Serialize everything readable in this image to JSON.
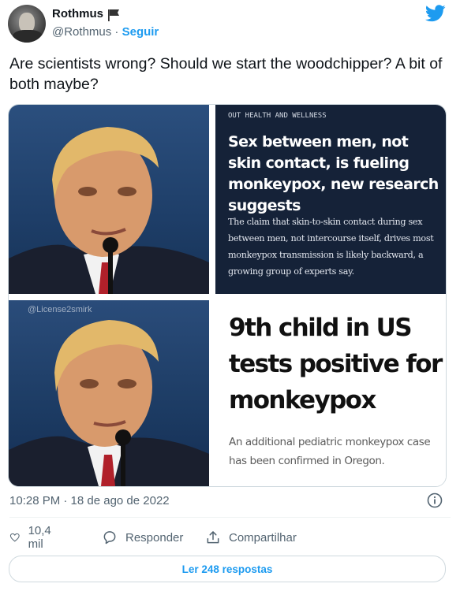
{
  "user": {
    "name": "Rothmus",
    "handle": "@Rothmus",
    "separator": "·",
    "follow_label": "Seguir"
  },
  "tweet": {
    "text": "Are scientists wrong? Should we start the woodchipper? A bit of both maybe?",
    "timestamp": "10:28 PM · 18 de ago de 2022"
  },
  "media": {
    "watermark": "@License2smirk",
    "article1": {
      "kicker": "OUT HEALTH AND WELLNESS",
      "headline": "Sex between men, not skin contact, is fueling monkeypox, new research suggests",
      "subhead": "The claim that skin-to-skin contact during sex between men, not intercourse itself, drives most monkeypox transmission is likely backward, a growing group of experts say."
    },
    "article2": {
      "headline": "9th child in US tests positive for monkeypox",
      "subhead": "An additional pediatric monkeypox case has been confirmed in Oregon."
    }
  },
  "actions": {
    "likes": "10,4 mil",
    "reply_label": "Responder",
    "share_label": "Compartilhar"
  },
  "read_replies_label": "Ler 248 respostas",
  "icons": {
    "flag": "black-flag-icon",
    "brand": "twitter-bird-icon",
    "info": "info-icon",
    "like": "heart-icon",
    "reply": "reply-bubble-icon",
    "share": "share-icon"
  },
  "colors": {
    "accent": "#1d9bf0",
    "secondary_text": "#536471",
    "article1_bg": "#152238"
  }
}
